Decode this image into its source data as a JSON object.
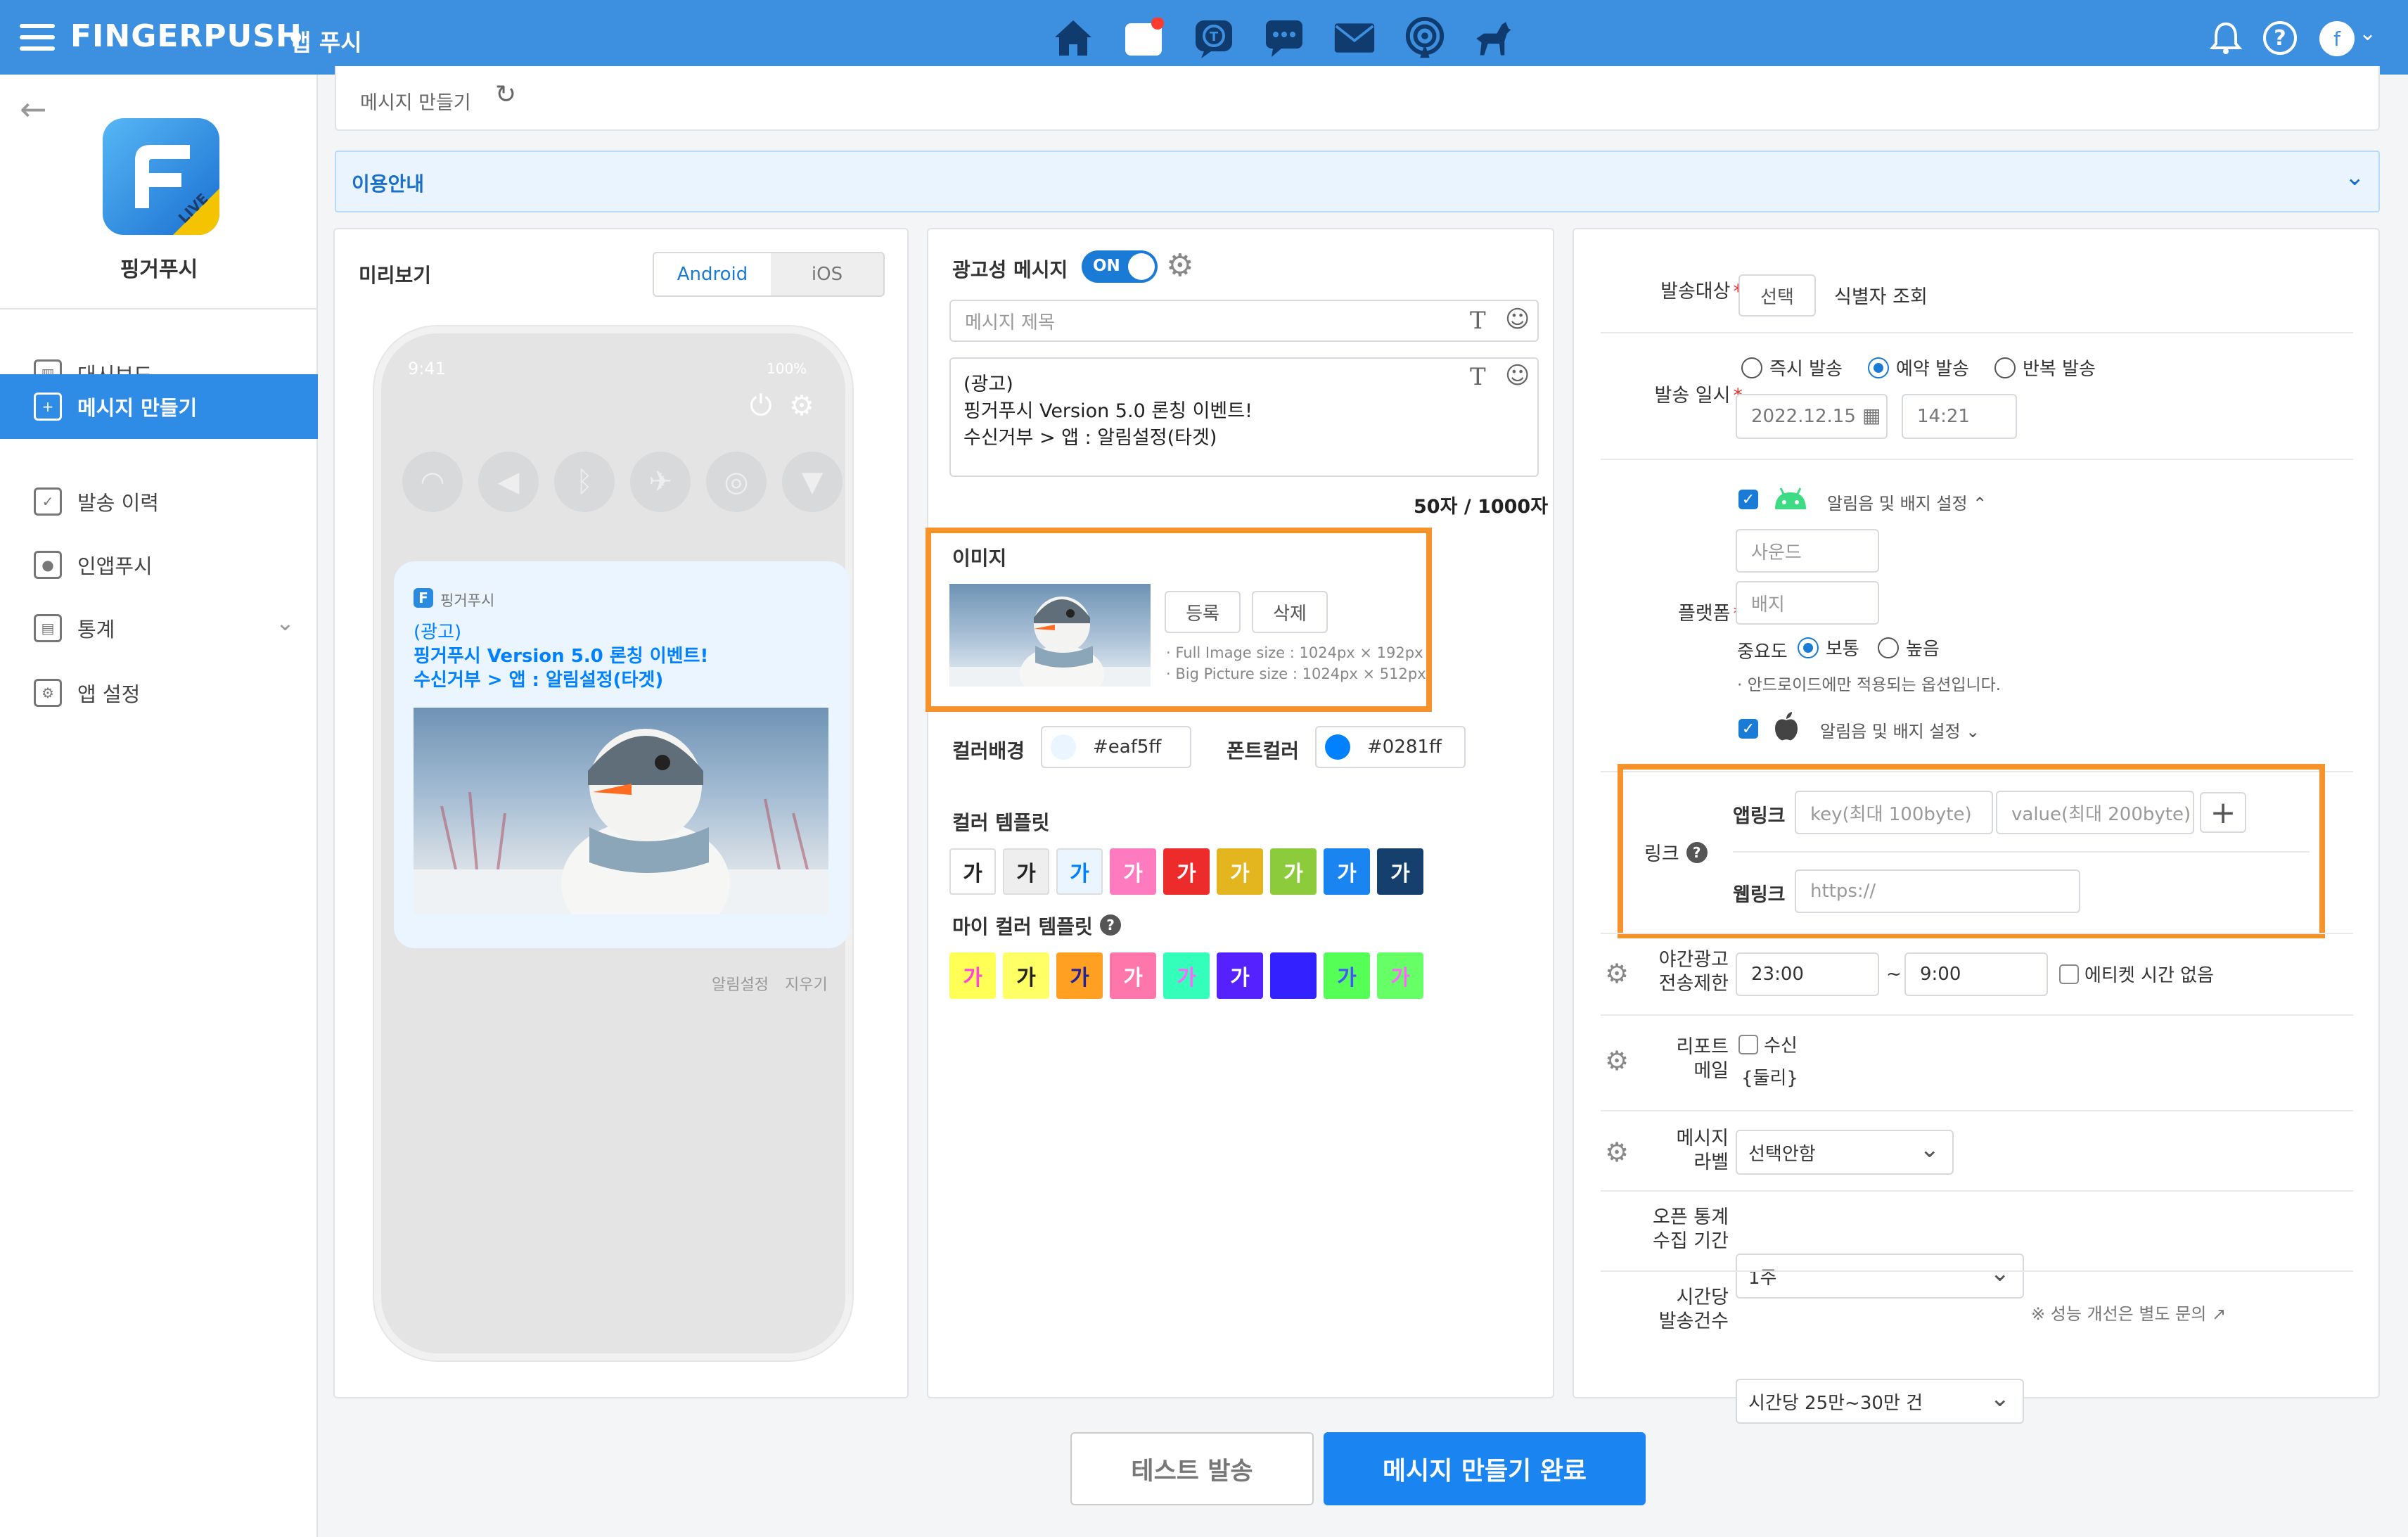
{
  "header": {
    "brand": "FINGERPUSH",
    "product": "앱 푸시",
    "icons": [
      "home-icon",
      "inbox-icon",
      "talk-icon",
      "chat-icon",
      "mail-icon",
      "broadcast-icon",
      "dog-icon"
    ],
    "avatar_letter": "f"
  },
  "sidebar": {
    "app_name": "핑거푸시",
    "logo_badge": "LIVE",
    "items": [
      {
        "label": "대시보드"
      },
      {
        "label": "메시지 만들기"
      },
      {
        "label": "발송 이력"
      },
      {
        "label": "인앱푸시"
      },
      {
        "label": "통계"
      },
      {
        "label": "앱 설정"
      }
    ]
  },
  "breadcrumb": {
    "title": "메시지 만들기"
  },
  "info_bar": {
    "label": "이용안내"
  },
  "preview": {
    "title": "미리보기",
    "tabs": [
      "Android",
      "iOS"
    ],
    "active_tab": "Android",
    "phone_time": "9:41",
    "phone_battery": "100%",
    "notif_app": "핑거푸시",
    "notif_lines": [
      "(광고)",
      "핑거푸시 Version 5.0 론칭 이벤트!",
      "수신거부 > 앱 : 알림설정(타겟)"
    ],
    "footer_links": [
      "알림설정",
      "지우기"
    ]
  },
  "compose": {
    "ad_label": "광고성 메시지",
    "ad_toggle": "ON",
    "title_placeholder": "메시지 제목",
    "body_lines": [
      "(광고)",
      "핑거푸시 Version 5.0 론칭 이벤트!",
      "수신거부 > 앱 : 알림설정(타겟)"
    ],
    "counter": "50자 / 1000자",
    "image_label": "이미지",
    "register_btn": "등록",
    "delete_btn": "삭제",
    "image_notes": [
      "· Full Image size : 1024px × 192px",
      "· Big Picture size : 1024px × 512px"
    ],
    "bg_color_label": "컬러배경",
    "bg_color_value": "#eaf5ff",
    "font_color_label": "폰트컬러",
    "font_color_value": "#0281ff",
    "color_template_label": "컬러 템플릿",
    "my_color_template_label": "마이 컬러 템플릿",
    "swatch_glyph": "가",
    "color_templates": [
      {
        "bg": "#ffffff",
        "fg": "#222222"
      },
      {
        "bg": "#eeeeee",
        "fg": "#222222"
      },
      {
        "bg": "#eaf5ff",
        "fg": "#0281ff"
      },
      {
        "bg": "#ff7bbf",
        "fg": "#ffffff"
      },
      {
        "bg": "#ee2b2b",
        "fg": "#ffffff"
      },
      {
        "bg": "#e3b51e",
        "fg": "#ffffff"
      },
      {
        "bg": "#8ccc3c",
        "fg": "#ffffff"
      },
      {
        "bg": "#1a85f0",
        "fg": "#ffffff"
      },
      {
        "bg": "#15406e",
        "fg": "#ffffff"
      }
    ],
    "my_color_templates": [
      {
        "bg": "#ffff55",
        "fg": "#ff44dd"
      },
      {
        "bg": "#ffff66",
        "fg": "#222222"
      },
      {
        "bg": "#ffa022",
        "fg": "#222299"
      },
      {
        "bg": "#ff77aa",
        "fg": "#ffffff"
      },
      {
        "bg": "#33ffbb",
        "fg": "#ff66ff"
      },
      {
        "bg": "#5522ff",
        "fg": "#ffffff"
      },
      {
        "bg": "#3322ff",
        "fg": "#3322ff"
      },
      {
        "bg": "#55ff55",
        "fg": "#4455ff"
      },
      {
        "bg": "#66ff66",
        "fg": "#ff66ff"
      }
    ]
  },
  "settings": {
    "target_label": "발송대상",
    "target_btn": "선택",
    "target_link": "식별자 조회",
    "datetime_label": "발송 일시",
    "send_options": [
      "즉시 발송",
      "예약 발송",
      "반복 발송"
    ],
    "date": "2022.12.15",
    "time": "14:21",
    "platform_label": "플랫폼",
    "android_setting": "알림음 및 배지 설정",
    "sound_placeholder": "사운드",
    "badge_placeholder": "배지",
    "priority_label": "중요도",
    "priority_options": [
      "보통",
      "높음"
    ],
    "priority_note": "· 안드로이드에만 적용되는 옵션입니다.",
    "ios_setting": "알림음 및 배지 설정",
    "link_label": "링크",
    "applink_label": "앱링크",
    "applink_key_placeholder": "key(최대 100byte)",
    "applink_value_placeholder": "value(최대 200byte)",
    "weblink_label": "웹링크",
    "weblink_placeholder": "https://",
    "night_label_1": "야간광고",
    "night_label_2": "전송제한",
    "night_start": "23:00",
    "night_sep": "~",
    "night_end": "9:00",
    "etiquette_label": "에티켓 시간 없음",
    "report_label_1": "리포트",
    "report_label_2": "메일",
    "report_receive": "수신",
    "report_user": "{둘리}",
    "msg_label_1": "메시지",
    "msg_label_2": "라벨",
    "msg_label_value": "선택안함",
    "stats_label_1": "오픈 통계",
    "stats_label_2": "수집 기간",
    "stats_value": "1주",
    "rate_label_1": "시간당",
    "rate_label_2": "발송건수",
    "rate_value": "시간당 25만~30만 건",
    "rate_note": "※ 성능 개선은 별도 문의"
  },
  "footer": {
    "test_btn": "테스트 발송",
    "submit_btn": "메시지 만들기 완료"
  },
  "colors": {
    "header": "#3d8fe0",
    "primary": "#1a7bd6",
    "highlight": "#f7932b"
  }
}
